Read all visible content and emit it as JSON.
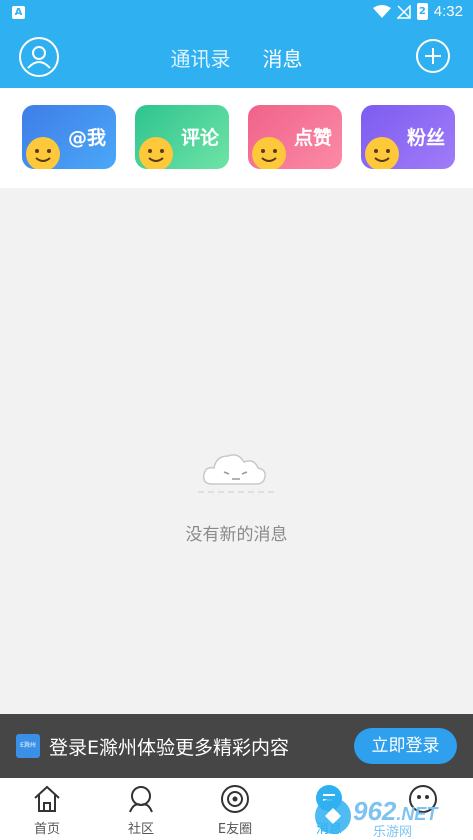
{
  "status_bar": {
    "time": "4:32",
    "battery": "2",
    "notif_letter": "A"
  },
  "header": {
    "tabs": [
      {
        "label": "通讯录",
        "active": false
      },
      {
        "label": "消息",
        "active": true
      }
    ]
  },
  "quick_cards": [
    {
      "label": "@我",
      "color_from": "#3f7de8",
      "color_to": "#4aa8f8"
    },
    {
      "label": "评论",
      "color_from": "#2ec48f",
      "color_to": "#6fe3a6"
    },
    {
      "label": "点赞",
      "color_from": "#f0628a",
      "color_to": "#fb8ba7"
    },
    {
      "label": "粉丝",
      "color_from": "#7d5cf0",
      "color_to": "#a07cf8"
    }
  ],
  "empty_state": {
    "message": "没有新的消息"
  },
  "login_banner": {
    "logo_text": "E滁州",
    "text": "登录E滁州体验更多精彩内容",
    "button": "立即登录"
  },
  "bottom_nav": [
    {
      "label": "首页",
      "icon": "home-icon",
      "active": false
    },
    {
      "label": "社区",
      "icon": "community-icon",
      "active": false
    },
    {
      "label": "E友圈",
      "icon": "circle-icon",
      "active": false
    },
    {
      "label": "消息",
      "icon": "message-icon",
      "active": true
    },
    {
      "label": "",
      "icon": "mine-icon",
      "active": false
    }
  ],
  "watermark": {
    "text": "962",
    "suffix": ".NET",
    "sub": "乐游网"
  },
  "colors": {
    "primary": "#2fb0f0",
    "banner_bg": "#464646"
  }
}
